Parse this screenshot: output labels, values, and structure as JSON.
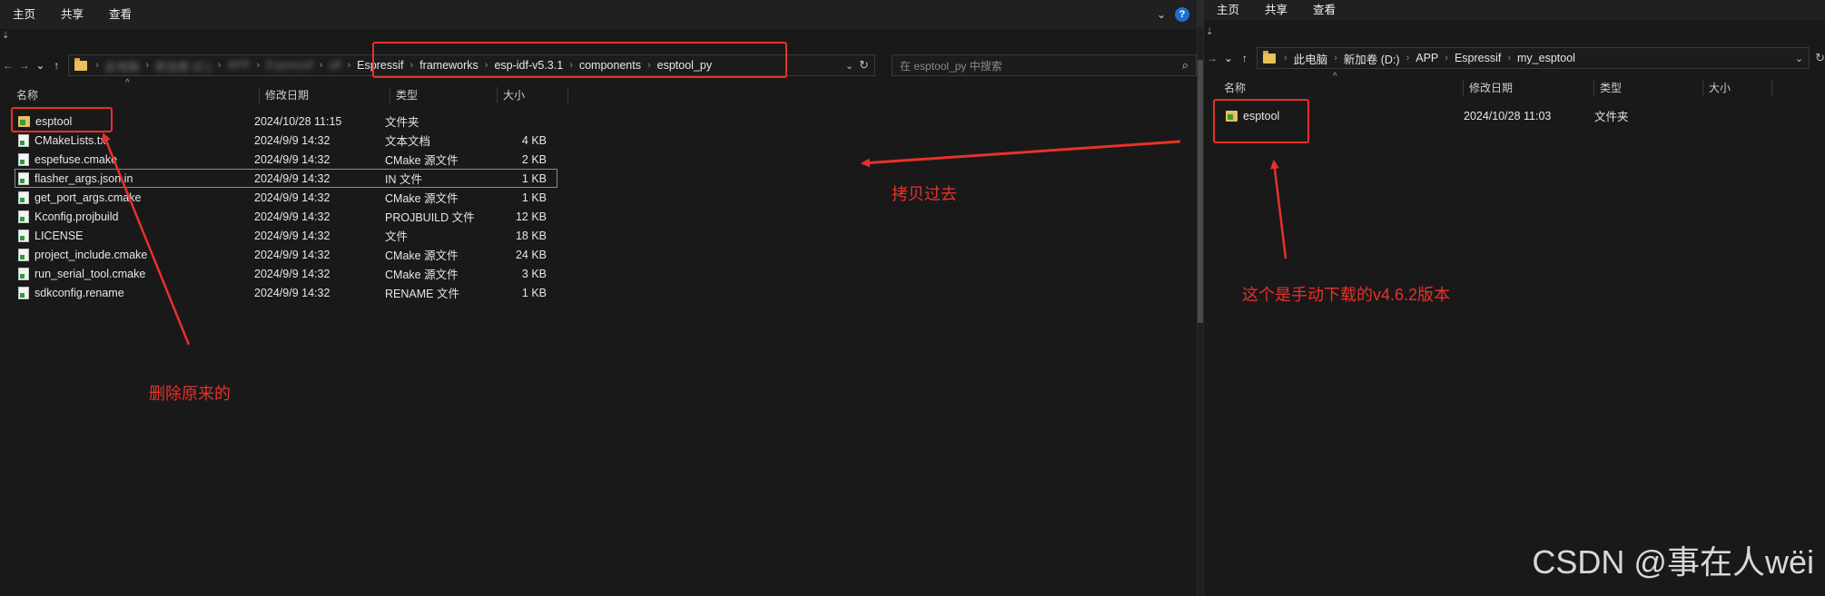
{
  "colors": {
    "annotation": "#e8312a",
    "background": "#191919",
    "text": "#e6e6e6",
    "help": "#1f6fcf"
  },
  "left": {
    "ribbon": {
      "tabs": [
        "主页",
        "共享",
        "查看"
      ]
    },
    "qa_glyph": "⇣",
    "nav": {
      "back": "←",
      "forward": "→",
      "recent": "⌄",
      "up": "↑"
    },
    "address": {
      "blurred": [
        "此电脑",
        "新加卷 (D:)",
        "APP",
        "Espressif",
        "idf"
      ],
      "crumbs": [
        "Espressif",
        "frameworks",
        "esp-idf-v5.3.1",
        "components",
        "esptool_py"
      ],
      "dropdown": "⌄",
      "refresh": "↻"
    },
    "search": {
      "placeholder": "在 esptool_py 中搜索",
      "icon": "⌕"
    },
    "columns": {
      "name": "名称",
      "date": "修改日期",
      "type": "类型",
      "size": "大小"
    },
    "files": [
      {
        "name": "esptool",
        "date": "2024/10/28 11:15",
        "type": "文件夹",
        "size": "",
        "icon": "folder-icon"
      },
      {
        "name": "CMakeLists.txt",
        "date": "2024/9/9 14:32",
        "type": "文本文档",
        "size": "4 KB",
        "icon": "file-icon"
      },
      {
        "name": "espefuse.cmake",
        "date": "2024/9/9 14:32",
        "type": "CMake 源文件",
        "size": "2 KB",
        "icon": "file-icon"
      },
      {
        "name": "flasher_args.json.in",
        "date": "2024/9/9 14:32",
        "type": "IN 文件",
        "size": "1 KB",
        "icon": "file-icon"
      },
      {
        "name": "get_port_args.cmake",
        "date": "2024/9/9 14:32",
        "type": "CMake 源文件",
        "size": "1 KB",
        "icon": "file-icon"
      },
      {
        "name": "Kconfig.projbuild",
        "date": "2024/9/9 14:32",
        "type": "PROJBUILD 文件",
        "size": "12 KB",
        "icon": "file-icon"
      },
      {
        "name": "LICENSE",
        "date": "2024/9/9 14:32",
        "type": "文件",
        "size": "18 KB",
        "icon": "file-icon"
      },
      {
        "name": "project_include.cmake",
        "date": "2024/9/9 14:32",
        "type": "CMake 源文件",
        "size": "24 KB",
        "icon": "file-icon"
      },
      {
        "name": "run_serial_tool.cmake",
        "date": "2024/9/9 14:32",
        "type": "CMake 源文件",
        "size": "3 KB",
        "icon": "file-icon"
      },
      {
        "name": "sdkconfig.rename",
        "date": "2024/9/9 14:32",
        "type": "RENAME 文件",
        "size": "1 KB",
        "icon": "file-icon"
      }
    ]
  },
  "right": {
    "ribbon": {
      "tabs": [
        "主页",
        "共享",
        "查看"
      ]
    },
    "qa_glyph": "⇣",
    "nav": {
      "back": "←",
      "forward": "→",
      "recent": "⌄",
      "up": "↑"
    },
    "address": {
      "crumbs": [
        "此电脑",
        "新加卷 (D:)",
        "APP",
        "Espressif",
        "my_esptool"
      ],
      "dropdown": "⌄",
      "refresh": "↻"
    },
    "columns": {
      "name": "名称",
      "date": "修改日期",
      "type": "类型",
      "size": "大小"
    },
    "files": [
      {
        "name": "esptool",
        "date": "2024/10/28 11:03",
        "type": "文件夹",
        "size": "",
        "icon": "folder-icon"
      }
    ]
  },
  "ui_glyphs": {
    "ribbon_chevron": "⌄",
    "help": "?",
    "sort_caret": "^"
  },
  "annotations": {
    "copy": "拷贝过去",
    "delete": "删除原来的",
    "manual": "这个是手动下载的v4.6.2版本"
  },
  "watermark": "CSDN @事在人wëi"
}
